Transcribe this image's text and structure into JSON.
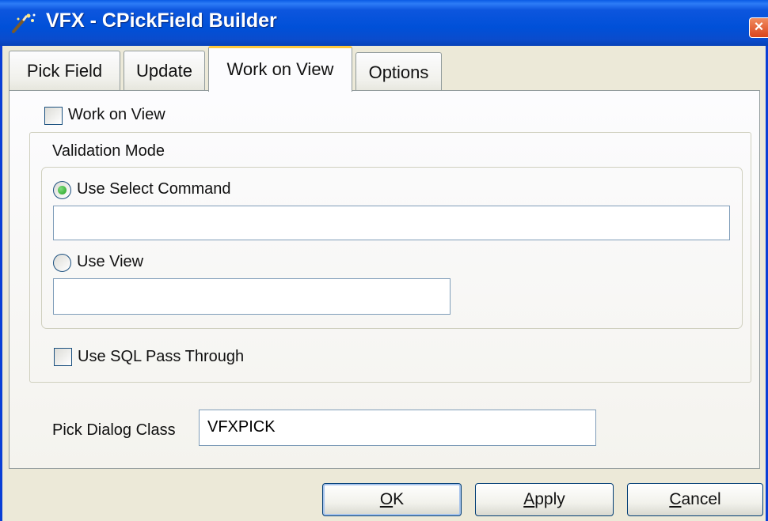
{
  "window": {
    "title": "VFX - CPickField Builder",
    "close_glyph": "×",
    "app_icon": "wand-icon"
  },
  "tabs": [
    {
      "label": "Pick Field",
      "active": false
    },
    {
      "label": "Update",
      "active": false
    },
    {
      "label": "Work on View",
      "active": true
    },
    {
      "label": "Options",
      "active": false
    }
  ],
  "work_on_view": {
    "checkbox_label": "Work on View",
    "checked": false,
    "group_title": "Validation Mode",
    "use_select_label": "Use Select Command",
    "use_select_selected": true,
    "select_command_value": "",
    "use_view_label": "Use View",
    "use_view_selected": false,
    "view_value": "",
    "sql_pass_through_label": "Use SQL Pass Through",
    "sql_pass_through_checked": false
  },
  "pick_dialog": {
    "label": "Pick Dialog Class",
    "value": "VFXPICK"
  },
  "buttons": {
    "ok": {
      "mnemonic": "O",
      "rest": "K"
    },
    "apply": {
      "mnemonic": "A",
      "rest": "pply"
    },
    "cancel": {
      "mnemonic": "C",
      "rest": "ancel"
    }
  },
  "colors": {
    "titlebar": "#0050d8",
    "face": "#ece9d8",
    "active_tab_accent": "#ffc83c",
    "radio_dot": "#21a121",
    "close_button": "#d9441c"
  }
}
